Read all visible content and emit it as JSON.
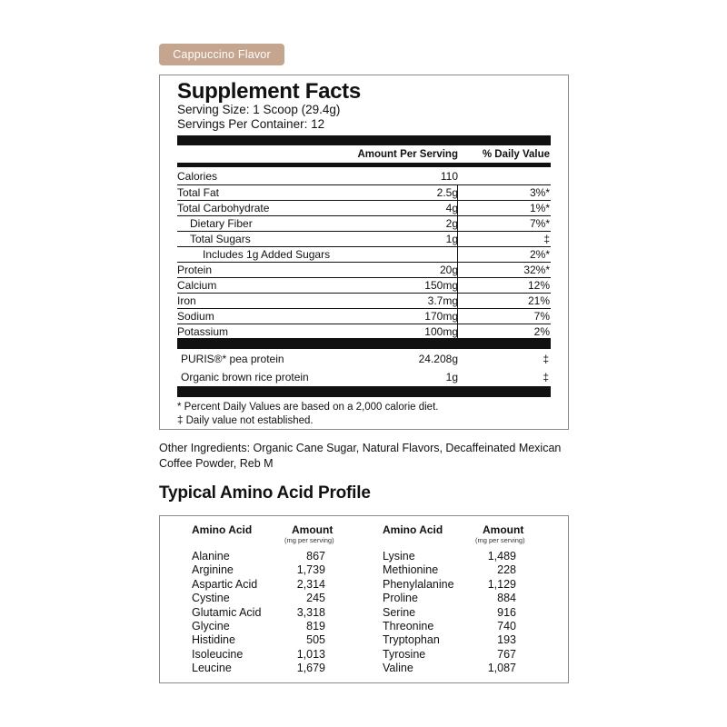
{
  "flavor": "Cappuccino Flavor",
  "facts": {
    "title": "Supplement Facts",
    "serving_size": "Serving Size: 1 Scoop (29.4g)",
    "servings_per_container": "Servings Per Container: 12",
    "header_amount": "Amount Per Serving",
    "header_dv": "% Daily Value",
    "nutrients": [
      {
        "name": "Calories",
        "amount": "110",
        "dv": ""
      },
      {
        "name": "Total Fat",
        "amount": "2.5g",
        "dv": "3%*"
      },
      {
        "name": "Total Carbohydrate",
        "amount": "4g",
        "dv": "1%*"
      },
      {
        "name": "Dietary Fiber",
        "amount": "2g",
        "dv": "7%*"
      },
      {
        "name": "Total Sugars",
        "amount": "1g",
        "dv": "‡"
      },
      {
        "name": "Includes 1g Added Sugars",
        "amount": "",
        "dv": "2%*"
      },
      {
        "name": "Protein",
        "amount": "20g",
        "dv": "32%*"
      },
      {
        "name": "Calcium",
        "amount": "150mg",
        "dv": "12%"
      },
      {
        "name": "Iron",
        "amount": "3.7mg",
        "dv": "21%"
      },
      {
        "name": "Sodium",
        "amount": "170mg",
        "dv": "7%"
      },
      {
        "name": "Potassium",
        "amount": "100mg",
        "dv": "2%"
      }
    ],
    "ingredients": [
      {
        "name": "PURIS®* pea protein",
        "amount": "24.208g",
        "dv": "‡"
      },
      {
        "name": "Organic brown rice protein",
        "amount": "1g",
        "dv": "‡"
      }
    ],
    "footnote_dv": "* Percent Daily Values are based on a 2,000 calorie diet.",
    "footnote_na": "‡ Daily value not established."
  },
  "other_ingredients": "Other Ingredients: Organic Cane Sugar, Natural Flavors, Decaffeinated Mexican Coffee Powder, Reb M",
  "amino": {
    "title": "Typical Amino Acid Profile",
    "header_name": "Amino Acid",
    "header_amount": "Amount",
    "header_unit": "(mg per serving)",
    "left": [
      {
        "name": "Alanine",
        "value": "867"
      },
      {
        "name": "Arginine",
        "value": "1,739"
      },
      {
        "name": "Aspartic Acid",
        "value": "2,314"
      },
      {
        "name": "Cystine",
        "value": "245"
      },
      {
        "name": "Glutamic Acid",
        "value": "3,318"
      },
      {
        "name": "Glycine",
        "value": "819"
      },
      {
        "name": "Histidine",
        "value": "505"
      },
      {
        "name": "Isoleucine",
        "value": "1,013"
      },
      {
        "name": "Leucine",
        "value": "1,679"
      }
    ],
    "right": [
      {
        "name": "Lysine",
        "value": "1,489"
      },
      {
        "name": "Methionine",
        "value": "228"
      },
      {
        "name": "Phenylalanine",
        "value": "1,129"
      },
      {
        "name": "Proline",
        "value": "884"
      },
      {
        "name": "Serine",
        "value": "916"
      },
      {
        "name": "Threonine",
        "value": "740"
      },
      {
        "name": "Tryptophan",
        "value": "193"
      },
      {
        "name": "Tyrosine",
        "value": "767"
      },
      {
        "name": "Valine",
        "value": "1,087"
      }
    ]
  }
}
